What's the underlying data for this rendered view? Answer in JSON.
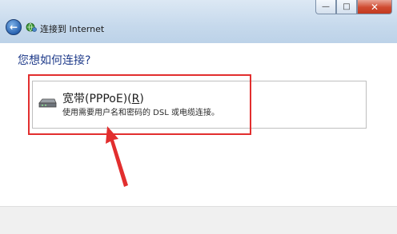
{
  "window": {
    "title": "连接到 Internet",
    "controls": {
      "minimize": "—",
      "maximize": "□",
      "close": "✕"
    }
  },
  "nav": {
    "back_label": "←"
  },
  "content": {
    "heading": "您想如何连接?",
    "option": {
      "title_main": "宽带(PPPoE)(",
      "title_key": "R",
      "title_end": ")",
      "description": "使用需要用户名和密码的 DSL 或电缆连接。",
      "icon": "modem-icon"
    }
  },
  "colors": {
    "highlight": "#e22e2e",
    "heading": "#1f3b8a",
    "titlebar": "#c6d9ec"
  }
}
